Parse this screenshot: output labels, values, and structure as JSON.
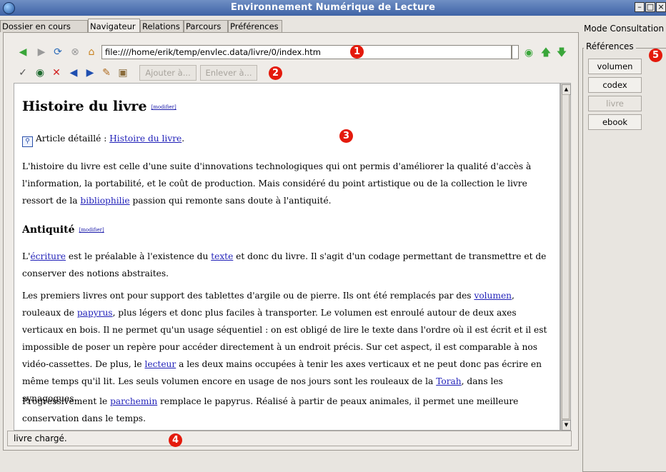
{
  "window": {
    "title": "Environnement Numérique de Lecture"
  },
  "tabs": [
    {
      "label": "Dossier en cours"
    },
    {
      "label": "Navigateur"
    },
    {
      "label": "Relations"
    },
    {
      "label": "Parcours"
    },
    {
      "label": "Préférences"
    }
  ],
  "navbar": {
    "url": "file:////home/erik/temp/envlec.data/livre/0/index.htm"
  },
  "toolbar2": {
    "add_label": "Ajouter à...",
    "remove_label": "Enlever à..."
  },
  "markers": [
    "1",
    "2",
    "3",
    "4",
    "5"
  ],
  "page": {
    "title": "Histoire du livre",
    "modifier": "[modifier]",
    "article_prefix": "Article détaillé : ",
    "article_link": "Histoire du livre",
    "article_suffix": ".",
    "p1": "L'histoire du livre est celle d'une suite d'innovations technologiques qui ont permis d'améliorer la qualité d'accès à l'information, la portabilité, et le coût de production. Mais considéré du point artistique ou de la collection le livre ressort de la",
    "p1_link": "bibliophilie",
    "p1_end": " passion qui remonte sans doute à l'antiquité.",
    "h2": "Antiquité",
    "p2_a": "L'",
    "p2_link1": "écriture",
    "p2_b": " est le préalable à l'existence du ",
    "p2_link2": "texte",
    "p2_c": " et donc du livre. Il s'agit d'un codage permettant de transmettre et de conserver des notions abstraites.",
    "p3_a": "Les premiers livres ont pour support des tablettes d'argile ou de pierre. Ils ont été remplacés par des ",
    "p3_link1": "volumen",
    "p3_b": ", rouleaux de ",
    "p3_link2": "papyrus",
    "p3_c": ", plus légers et donc plus faciles à transporter. Le volumen est enroulé autour de deux axes verticaux en bois. Il ne permet qu'un usage séquentiel : on est obligé de lire le texte dans l'ordre où il est écrit et il est impossible de poser un repère pour accéder directement à un endroit précis. Sur cet aspect, il est comparable à nos vidéo-cassettes. De plus, le ",
    "p3_link3": "lecteur",
    "p3_d": " a les deux mains occupées à tenir les axes verticaux et ne peut donc pas écrire en même temps qu'il lit. Les seuls volumen encore en usage de nos jours sont les rouleaux de la ",
    "p3_link4": "Torah",
    "p3_e": ", dans les synagogues.",
    "p4_a": "Progressivement le ",
    "p4_link": "parchemin",
    "p4_b": " remplace le papyrus. Réalisé à partir de peaux animales, il permet une meilleure conservation dans le temps."
  },
  "status": {
    "text": "livre chargé."
  },
  "right_panel": {
    "title": "Mode Consultation",
    "group_label": "Références",
    "buttons": [
      {
        "label": "volumen",
        "enabled": true
      },
      {
        "label": "codex",
        "enabled": true
      },
      {
        "label": "livre",
        "enabled": false
      },
      {
        "label": "ebook",
        "enabled": true
      }
    ]
  },
  "icons": {
    "nav": [
      "back-arrow-icon",
      "forward-arrow-icon",
      "reload-icon",
      "stop-icon",
      "home-icon",
      "go-icon",
      "up-arrow-icon",
      "down-arrow-icon"
    ],
    "toolbar": [
      "bookmark-icon",
      "search-globe-icon",
      "delete-icon",
      "prev-icon",
      "next-icon",
      "edit-icon",
      "properties-icon"
    ]
  },
  "colors": {
    "accent_red": "#e41a0c",
    "nav_green": "#3aa63a",
    "link_blue": "#1f1fb8"
  }
}
